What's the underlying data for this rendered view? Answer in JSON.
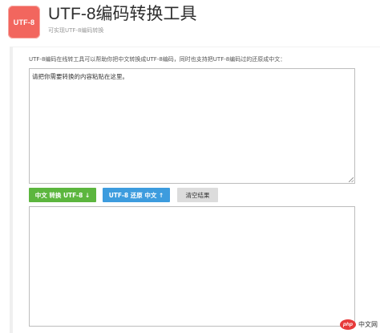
{
  "header": {
    "logo_text": "UTF-8",
    "title": "UTF-8编码转换工具",
    "subtitle": "可实现UTF-8编码转换"
  },
  "main": {
    "description": "UTF-8编码在线转工具可以帮助你把中文转换成UTF-8编码，同时也支持把UTF-8编码过的还原成中文：",
    "input": {
      "value": "请把你需要转换的内容粘贴在这里。"
    },
    "buttons": {
      "encode_label": "中文 转换 UTF-8 ↓",
      "decode_label": "UTF-8 还原 中文 ↑",
      "clear_label": "清空结果"
    },
    "output": {
      "value": ""
    }
  },
  "watermark": {
    "logo_text": "php",
    "site_text": "中文网"
  },
  "colors": {
    "logo_bg": "#f2665e",
    "encode_button": "#5cb63e",
    "decode_button": "#3d9cde",
    "clear_button": "#dcdcdc"
  }
}
